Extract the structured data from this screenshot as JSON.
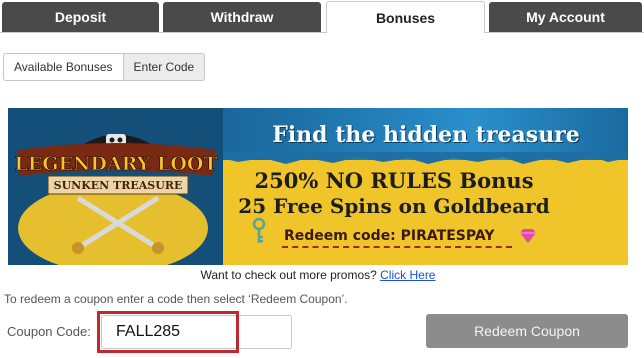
{
  "tabs": [
    {
      "label": "Deposit",
      "active": false
    },
    {
      "label": "Withdraw",
      "active": false
    },
    {
      "label": "Bonuses",
      "active": true
    },
    {
      "label": "My Account",
      "active": false
    }
  ],
  "subtabs": [
    {
      "label": "Available Bonuses",
      "active": false
    },
    {
      "label": "Enter Code",
      "active": true
    }
  ],
  "banner": {
    "logo_line1": "LEGENDARY LOOT",
    "logo_line2": "SUNKEN TREASURE",
    "headline": "Find the hidden treasure",
    "offer_line1": "250% NO RULES Bonus",
    "offer_line2": "25 Free Spins on Goldbeard",
    "redeem_text": "Redeem code: PIRATESPAY",
    "icons": [
      "pirate-hat-icon",
      "crossed-swords-icon",
      "key-icon",
      "gem-icon"
    ]
  },
  "promo": {
    "text": "Want to check out more promos?",
    "link_label": "Click Here"
  },
  "instruction": "To redeem a coupon enter a code then select ‘Redeem Coupon’.",
  "coupon": {
    "label": "Coupon Code:",
    "value": "FALL285",
    "placeholder": ""
  },
  "redeem_button_label": "Redeem Coupon",
  "colors": {
    "tab_bg": "#4a4a4a",
    "banner_yellow": "#f0c52a",
    "banner_blue": "#1d6fa6",
    "highlight_red": "#c0282d",
    "link_blue": "#1a4fd6",
    "button_gray": "#8c8c8c"
  }
}
